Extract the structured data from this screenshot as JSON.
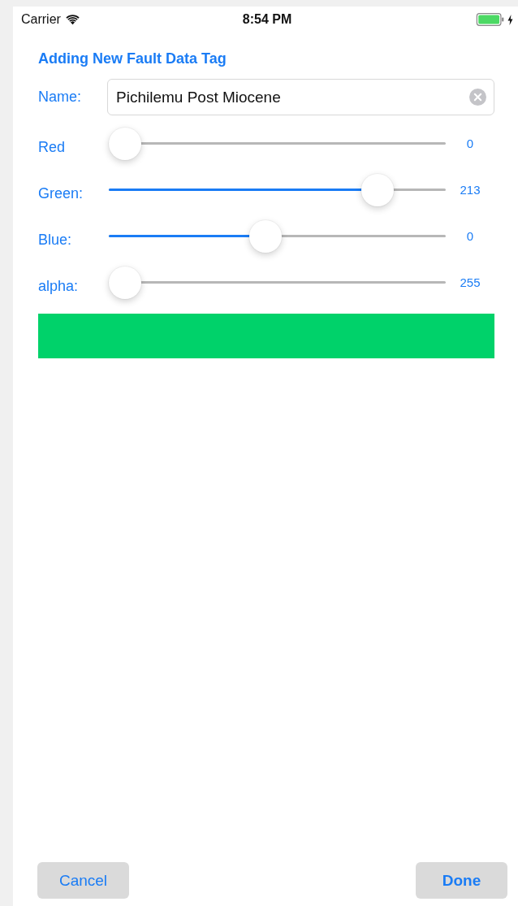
{
  "status_bar": {
    "carrier": "Carrier",
    "time": "8:54 PM",
    "charging": true
  },
  "title": "Adding New Fault Data Tag",
  "name_field": {
    "label": "Name:",
    "value": "Pichilemu Post Miocene"
  },
  "sliders": [
    {
      "label": "Red",
      "level": 0,
      "reading": "0"
    },
    {
      "label": "Green:",
      "level": 0.83,
      "reading": "213"
    },
    {
      "label": "Blue:",
      "level": 0.46,
      "reading": "0"
    },
    {
      "label": "alpha:",
      "level": 0,
      "reading": "255"
    }
  ],
  "preview": {
    "color": "#00d26a"
  },
  "buttons": [
    {
      "label": "Cancel",
      "kind": "cancel"
    },
    {
      "label": "Done",
      "kind": "done"
    }
  ]
}
